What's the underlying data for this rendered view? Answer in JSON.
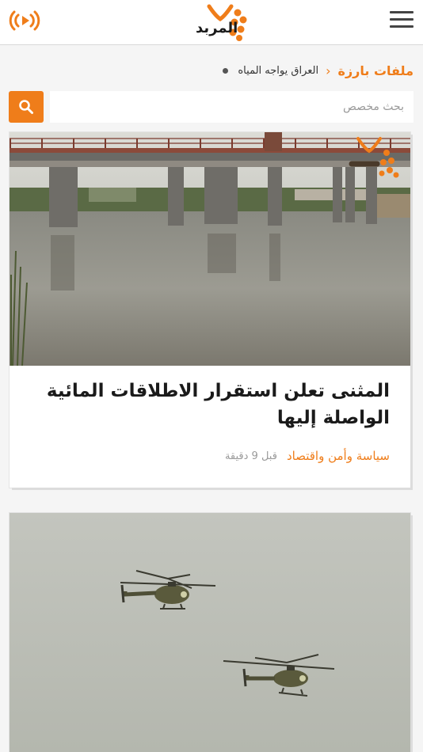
{
  "header": {
    "logo_text": "المربد",
    "accent": "#ef7d1a"
  },
  "breadcrumb": {
    "main": "ملفات بارزة",
    "separator": "‹",
    "sub": "العراق يواجه المياه"
  },
  "search": {
    "placeholder": "بحث مخصص"
  },
  "articles": [
    {
      "title": "المثنى تعلن استقرار الاطلاقات المائية الواصلة إليها",
      "category": "سياسة وأمن واقتصاد",
      "time": "قبل 9 دقيقة",
      "image": "river-bridge-photo"
    },
    {
      "image": "helicopters-photo"
    }
  ]
}
